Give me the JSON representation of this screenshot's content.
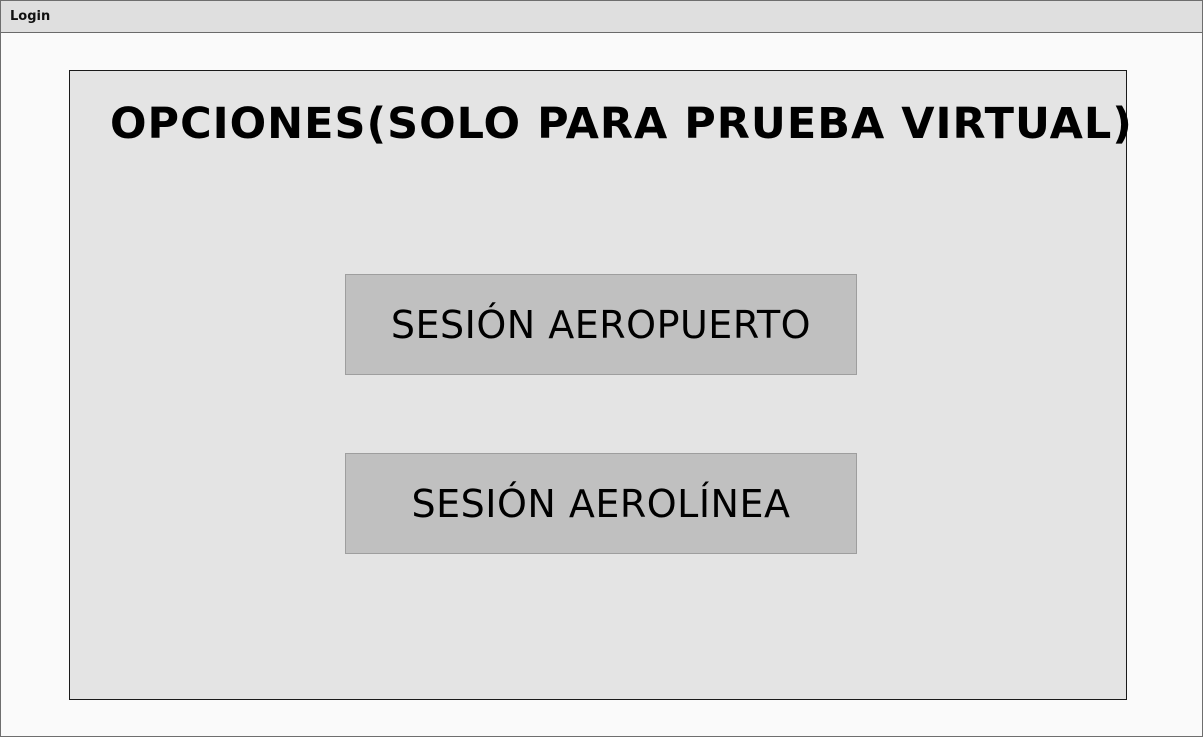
{
  "window": {
    "title": "Login"
  },
  "panel": {
    "heading": "OPCIONES(SOLO PARA PRUEBA VIRTUAL)",
    "buttons": {
      "airport_label": "SESIÓN AEROPUERTO",
      "airline_label": "SESIÓN AEROLÍNEA"
    }
  }
}
